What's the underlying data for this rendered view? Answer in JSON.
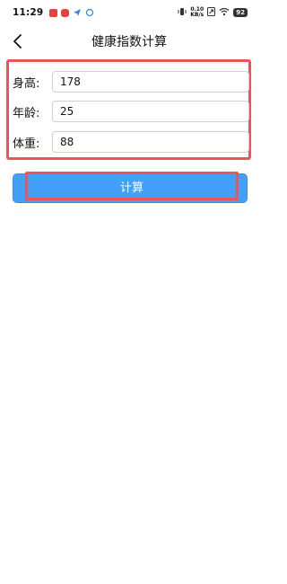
{
  "status_bar": {
    "time": "11:29",
    "net_speed_value": "0.10",
    "net_speed_unit": "KB/s",
    "battery": "92",
    "app_icons": [
      "notification-app-icon",
      "message-app-icon",
      "send-app-icon",
      "sync-app-icon"
    ]
  },
  "header": {
    "title": "健康指数计算",
    "back_icon": "chevron-left-icon"
  },
  "form": {
    "height": {
      "label": "身高:",
      "value": "178"
    },
    "age": {
      "label": "年龄:",
      "value": "25"
    },
    "weight": {
      "label": "体重:",
      "value": "88"
    }
  },
  "actions": {
    "calculate_label": "计算"
  },
  "colors": {
    "primary": "#42a0f8",
    "highlight": "#e9555a"
  }
}
